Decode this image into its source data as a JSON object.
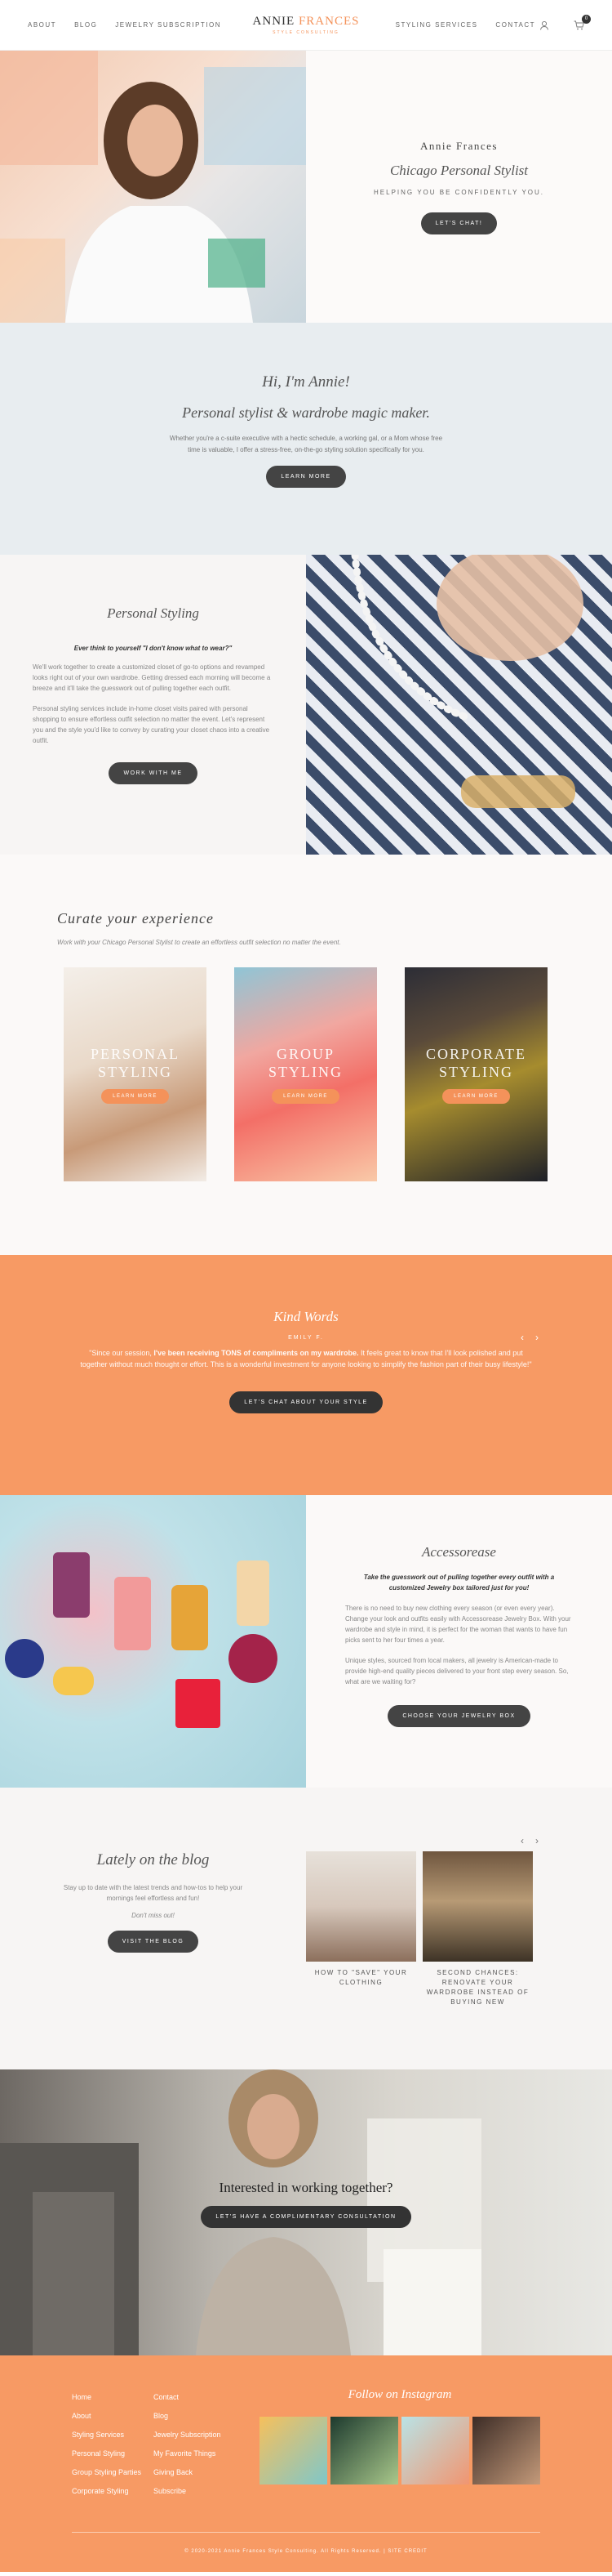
{
  "header": {
    "nav_left": [
      "ABOUT",
      "BLOG",
      "JEWELRY SUBSCRIPTION"
    ],
    "logo_first": "ANNIE",
    "logo_second": "FRANCES",
    "logo_tagline": "STYLE CONSULTING",
    "nav_right": [
      "STYLING SERVICES",
      "CONTACT"
    ],
    "cart_count": "0"
  },
  "hero": {
    "name": "Annie Frances",
    "subtitle": "Chicago Personal Stylist",
    "tagline": "HELPING YOU BE CONFIDENTLY YOU.",
    "button": "LET'S CHAT!"
  },
  "intro": {
    "heading": "Hi, I'm Annie!",
    "subheading": "Personal stylist & wardrobe magic maker.",
    "body": "Whether you're a c-suite executive with a hectic schedule, a working gal, or a Mom whose free time is valuable, I offer a stress-free, on-the-go styling solution specifically for you.",
    "button": "LEARN MORE"
  },
  "personal_styling": {
    "heading": "Personal Styling",
    "quote": "Ever think to yourself \"I don't know what to wear?\"",
    "p1": "We'll work together to create a customized closet of go-to options and revamped looks right out of your own wardrobe. Getting dressed each morning will become a breeze and it'll take the guesswork out of pulling together each outfit.",
    "p2": "Personal styling services include in-home closet visits paired with personal shopping to ensure effortless outfit selection no matter the event. Let's represent you and the style you'd like to convey by curating your closet chaos into a creative outfit.",
    "button": "WORK WITH ME"
  },
  "curate": {
    "heading": "Curate your experience",
    "intro": "Work with your Chicago Personal Stylist to create an effortless outfit selection no matter the event.",
    "cards": [
      {
        "title_line1": "PERSONAL",
        "title_line2": "STYLING",
        "button": "LEARN MORE"
      },
      {
        "title_line1": "GROUP",
        "title_line2": "STYLING",
        "button": "LEARN MORE"
      },
      {
        "title_line1": "CORPORATE",
        "title_line2": "STYLING",
        "button": "LEARN MORE"
      }
    ]
  },
  "testimonials": {
    "heading": "Kind Words",
    "author": "EMILY F.",
    "quote_start": "\"Since our session, ",
    "quote_bold": "I've been receiving TONS of compliments on my wardrobe.",
    "quote_end": " It feels great to know that I'll look polished and put together without much thought or effort. This is a wonderful investment for anyone looking to simplify the fashion part of their busy lifestyle!\"",
    "button": "LET'S CHAT ABOUT YOUR STYLE",
    "prev": "‹",
    "next": "›"
  },
  "accessorease": {
    "heading": "Accessorease",
    "quote": "Take the guesswork out of pulling together every outfit with a customized Jewelry box tailored just for you!",
    "p1": "There is no need to buy new clothing every season (or even every year). Change your look and outfits easily with Accessorease Jewelry Box. With your wardrobe and style in mind, it is perfect for the woman that wants to have fun picks sent to her four times a year.",
    "p2": "Unique styles, sourced from local makers, all jewelry is American-made to provide high-end quality pieces delivered to your front step every season. So, what are we waiting for?",
    "button": "CHOOSE YOUR JEWELRY BOX"
  },
  "blog": {
    "heading": "Lately on the blog",
    "body": "Stay up to date with the latest trends and how-tos to help your mornings feel effortless and fun!",
    "dont_miss": "Don't miss out!",
    "button": "VISIT THE BLOG",
    "posts": [
      {
        "title": "HOW TO \"SAVE\" YOUR CLOTHING"
      },
      {
        "title": "SECOND CHANCES: RENOVATE YOUR WARDROBE INSTEAD OF BUYING NEW"
      }
    ],
    "prev": "‹",
    "next": "›"
  },
  "cta": {
    "heading": "Interested in working together?",
    "button": "LET'S HAVE A COMPLIMENTARY CONSULTATION"
  },
  "footer": {
    "col1": [
      "Home",
      "About",
      "Styling Services",
      "Personal Styling",
      "Group Styling Parties",
      "Corporate Styling"
    ],
    "col2": [
      "Contact",
      "Blog",
      "Jewelry Subscription",
      "My Favorite Things",
      "Giving Back",
      "Subscribe"
    ],
    "instagram_heading": "Follow on Instagram",
    "copyright": "© 2020-2021 Annie Frances Style Consulting. All Rights Reserved. | SITE CREDIT"
  }
}
